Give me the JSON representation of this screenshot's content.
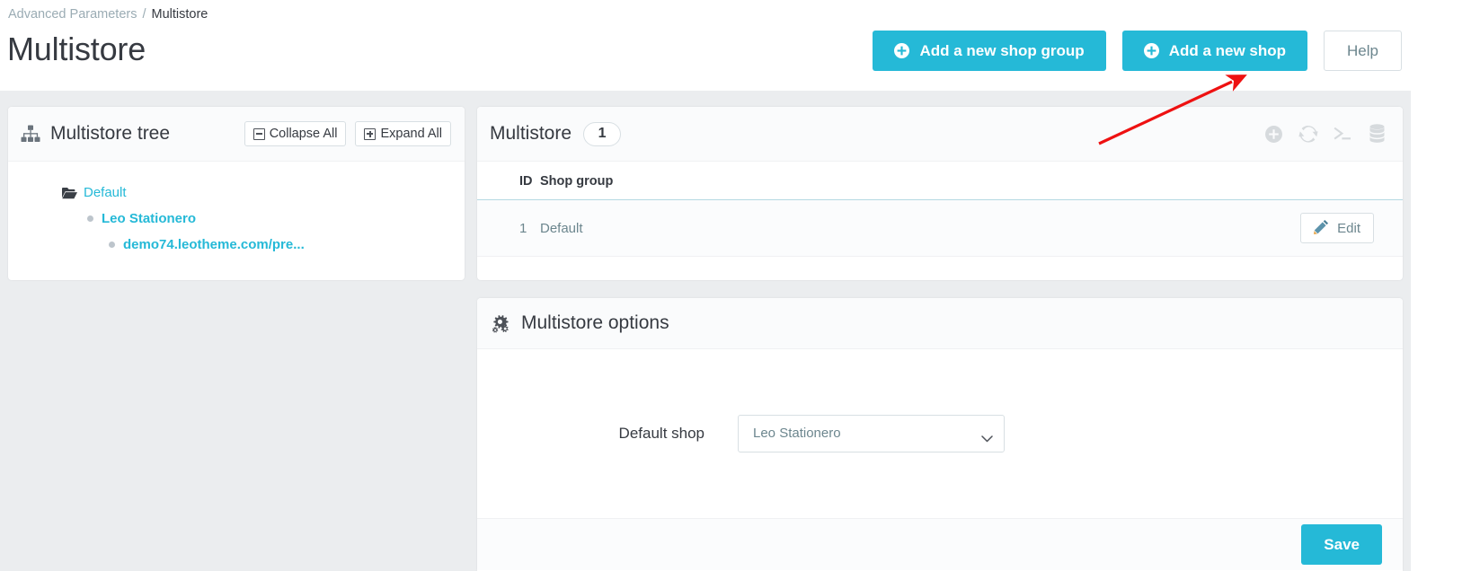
{
  "breadcrumb": {
    "parent": "Advanced Parameters",
    "separator": "/",
    "current": "Multistore"
  },
  "page": {
    "title": "Multistore"
  },
  "header_actions": {
    "add_shop_group_label": "Add a new shop group",
    "add_shop_label": "Add a new shop",
    "help_label": "Help",
    "primary_color": "#25b9d7"
  },
  "tree_panel": {
    "title": "Multistore tree",
    "icon": "sitemap-icon",
    "collapse_all_label": "Collapse All",
    "expand_all_label": "Expand All",
    "nodes": [
      {
        "label": "Default",
        "level": 0,
        "icon": "folder-open-icon",
        "bold": false
      },
      {
        "label": "Leo Stationero",
        "level": 1,
        "icon": "dot-icon",
        "bold": true
      },
      {
        "label": "demo74.leotheme.com/pre...",
        "level": 2,
        "icon": "dot-icon",
        "bold": true
      }
    ]
  },
  "list_panel": {
    "title": "Multistore",
    "count": "1",
    "tools": [
      "add-circle-icon",
      "refresh-icon",
      "terminal-icon",
      "database-icon"
    ],
    "table": {
      "columns": [
        "ID",
        "Shop group"
      ],
      "rows": [
        {
          "id": "1",
          "shop_group": "Default",
          "action_label": "Edit",
          "action_icon": "pencil-icon"
        }
      ]
    }
  },
  "options_panel": {
    "title": "Multistore options",
    "icon": "cogs-icon",
    "default_shop_label": "Default shop",
    "default_shop_value": "Leo Stationero",
    "default_shop_options": [
      "Leo Stationero"
    ],
    "save_label": "Save"
  },
  "annotation": {
    "type": "arrow",
    "color": "#ee1111",
    "points_at": "add-a-new-shop-button"
  }
}
